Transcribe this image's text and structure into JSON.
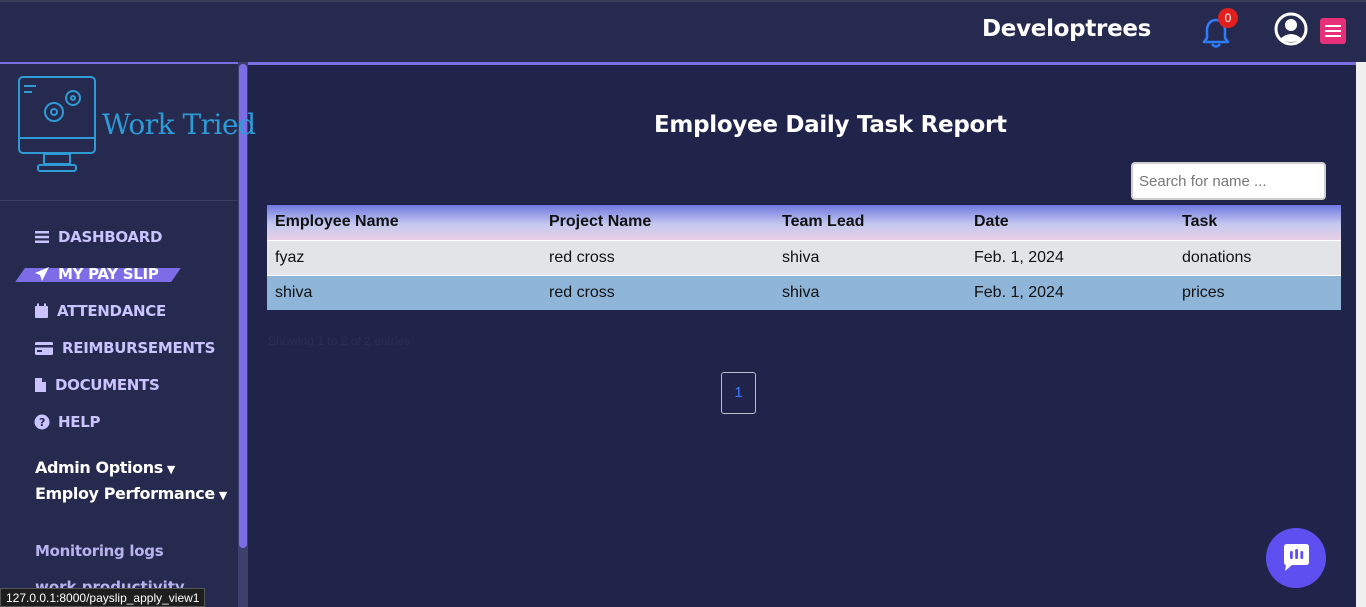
{
  "header": {
    "brand": "Developtrees",
    "notification_count": "0"
  },
  "sidebar": {
    "logo_text": "Work Tried",
    "nav": [
      {
        "label": "DASHBOARD",
        "icon": "list-icon"
      },
      {
        "label": "MY PAY SLIP",
        "icon": "paper-plane-icon",
        "active": true
      },
      {
        "label": "ATTENDANCE",
        "icon": "calendar-icon"
      },
      {
        "label": "REIMBURSEMENTS",
        "icon": "credit-card-icon"
      },
      {
        "label": "DOCUMENTS",
        "icon": "file-icon"
      },
      {
        "label": "HELP",
        "icon": "question-circle-icon"
      }
    ],
    "admin_options": "Admin Options",
    "employ_performance": "Employ Performance",
    "monitoring_logs": "Monitoring logs",
    "work_productivity": "work productivity"
  },
  "main": {
    "title": "Employee Daily Task Report",
    "search_placeholder": "Search for name ...",
    "table": {
      "headers": [
        "Employee Name",
        "Project Name",
        "Team Lead",
        "Date",
        "Task"
      ],
      "rows": [
        [
          "fyaz",
          "red cross",
          "shiva",
          "Feb. 1, 2024",
          "donations"
        ],
        [
          "shiva",
          "red cross",
          "shiva",
          "Feb. 1, 2024",
          "prices"
        ]
      ]
    },
    "entries_info": "Showing 1 to 2 of 2 entries",
    "pagination": {
      "current": "1"
    }
  },
  "status_bar": {
    "url": "127.0.0.1:8000/payslip_apply_view1"
  },
  "colors": {
    "accent": "#7c6ce6",
    "menu_button": "#e8307a",
    "badge": "#e1201e",
    "chat_button": "#5e4ff0"
  }
}
